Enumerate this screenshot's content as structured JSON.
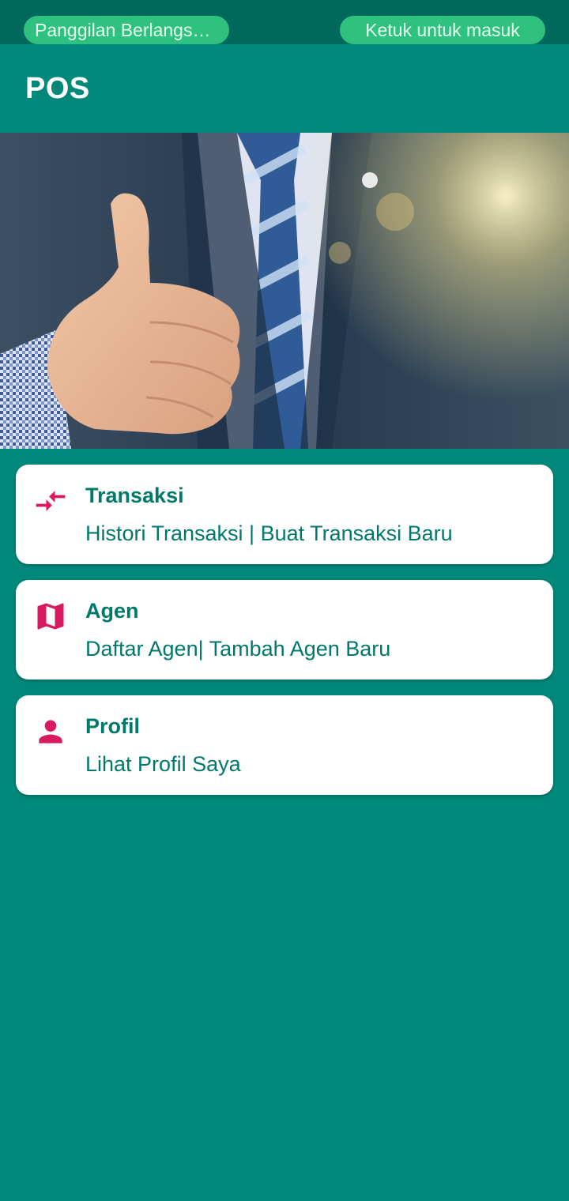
{
  "status_bar": {
    "ongoing_call": "Panggilan Berlangsun…",
    "tap_to_enter": "Ketuk untuk masuk"
  },
  "app_bar": {
    "title": "POS"
  },
  "banner": {
    "icon": "thumbs-up-businessman-photo"
  },
  "menu": [
    {
      "icon": "compare-arrows-icon",
      "title": "Transaksi",
      "subtitle": "Histori Transaksi | Buat Transaksi Baru"
    },
    {
      "icon": "map-icon",
      "title": "Agen",
      "subtitle": "Daftar Agen| Tambah Agen Baru"
    },
    {
      "icon": "person-icon",
      "title": "Profil",
      "subtitle": "Lihat Profil Saya"
    }
  ],
  "colors": {
    "primary": "#00897b",
    "primary_dark": "#00695c",
    "accent": "#d81b60",
    "pill": "#2ec27e",
    "card_text": "#00796b"
  }
}
